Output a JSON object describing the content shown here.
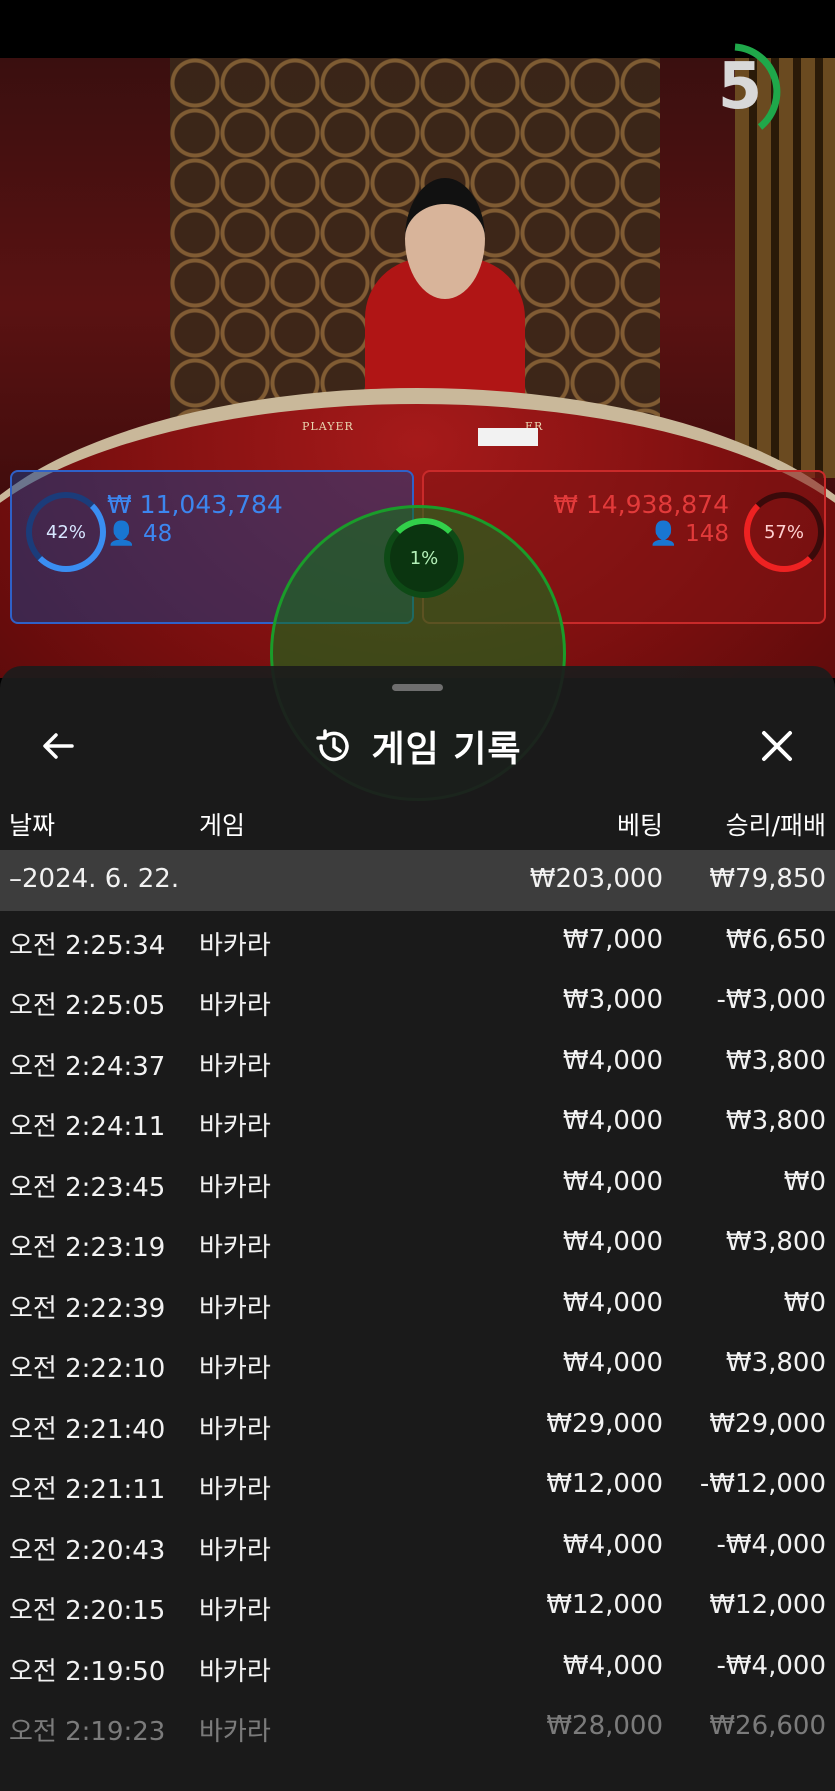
{
  "table": {
    "felt_left": "PLAYER",
    "felt_right": "ER",
    "timer": "5"
  },
  "bets": {
    "player": {
      "percent": "42%",
      "amount": "₩ 11,043,784",
      "players": "48"
    },
    "tie": {
      "percent": "1%"
    },
    "banker": {
      "percent": "57%",
      "amount": "₩ 14,938,874",
      "players": "148"
    }
  },
  "colors": {
    "player": "#3c86ef",
    "banker": "#e23a3a",
    "tie": "#32d04a"
  },
  "sheet": {
    "title": "게임 기록",
    "back_icon": "arrow-left-icon",
    "history_icon": "history-icon",
    "close_icon": "close-icon",
    "columns": {
      "date": "날짜",
      "game": "게임",
      "bet": "베팅",
      "result": "승리/패배"
    },
    "summary": {
      "date": "–2024. 6. 22.",
      "bet": "₩203,000",
      "result": "₩79,850"
    },
    "rows": [
      {
        "time": "오전 2:25:34",
        "game": "바카라",
        "bet": "₩7,000",
        "result": "₩6,650"
      },
      {
        "time": "오전 2:25:05",
        "game": "바카라",
        "bet": "₩3,000",
        "result": "-₩3,000"
      },
      {
        "time": "오전 2:24:37",
        "game": "바카라",
        "bet": "₩4,000",
        "result": "₩3,800"
      },
      {
        "time": "오전 2:24:11",
        "game": "바카라",
        "bet": "₩4,000",
        "result": "₩3,800"
      },
      {
        "time": "오전 2:23:45",
        "game": "바카라",
        "bet": "₩4,000",
        "result": "₩0"
      },
      {
        "time": "오전 2:23:19",
        "game": "바카라",
        "bet": "₩4,000",
        "result": "₩3,800"
      },
      {
        "time": "오전 2:22:39",
        "game": "바카라",
        "bet": "₩4,000",
        "result": "₩0"
      },
      {
        "time": "오전 2:22:10",
        "game": "바카라",
        "bet": "₩4,000",
        "result": "₩3,800"
      },
      {
        "time": "오전 2:21:40",
        "game": "바카라",
        "bet": "₩29,000",
        "result": "₩29,000"
      },
      {
        "time": "오전 2:21:11",
        "game": "바카라",
        "bet": "₩12,000",
        "result": "-₩12,000"
      },
      {
        "time": "오전 2:20:43",
        "game": "바카라",
        "bet": "₩4,000",
        "result": "-₩4,000"
      },
      {
        "time": "오전 2:20:15",
        "game": "바카라",
        "bet": "₩12,000",
        "result": "₩12,000"
      },
      {
        "time": "오전 2:19:50",
        "game": "바카라",
        "bet": "₩4,000",
        "result": "-₩4,000"
      },
      {
        "time": "오전 2:19:23",
        "game": "바카라",
        "bet": "₩28,000",
        "result": "₩26,600"
      }
    ]
  }
}
